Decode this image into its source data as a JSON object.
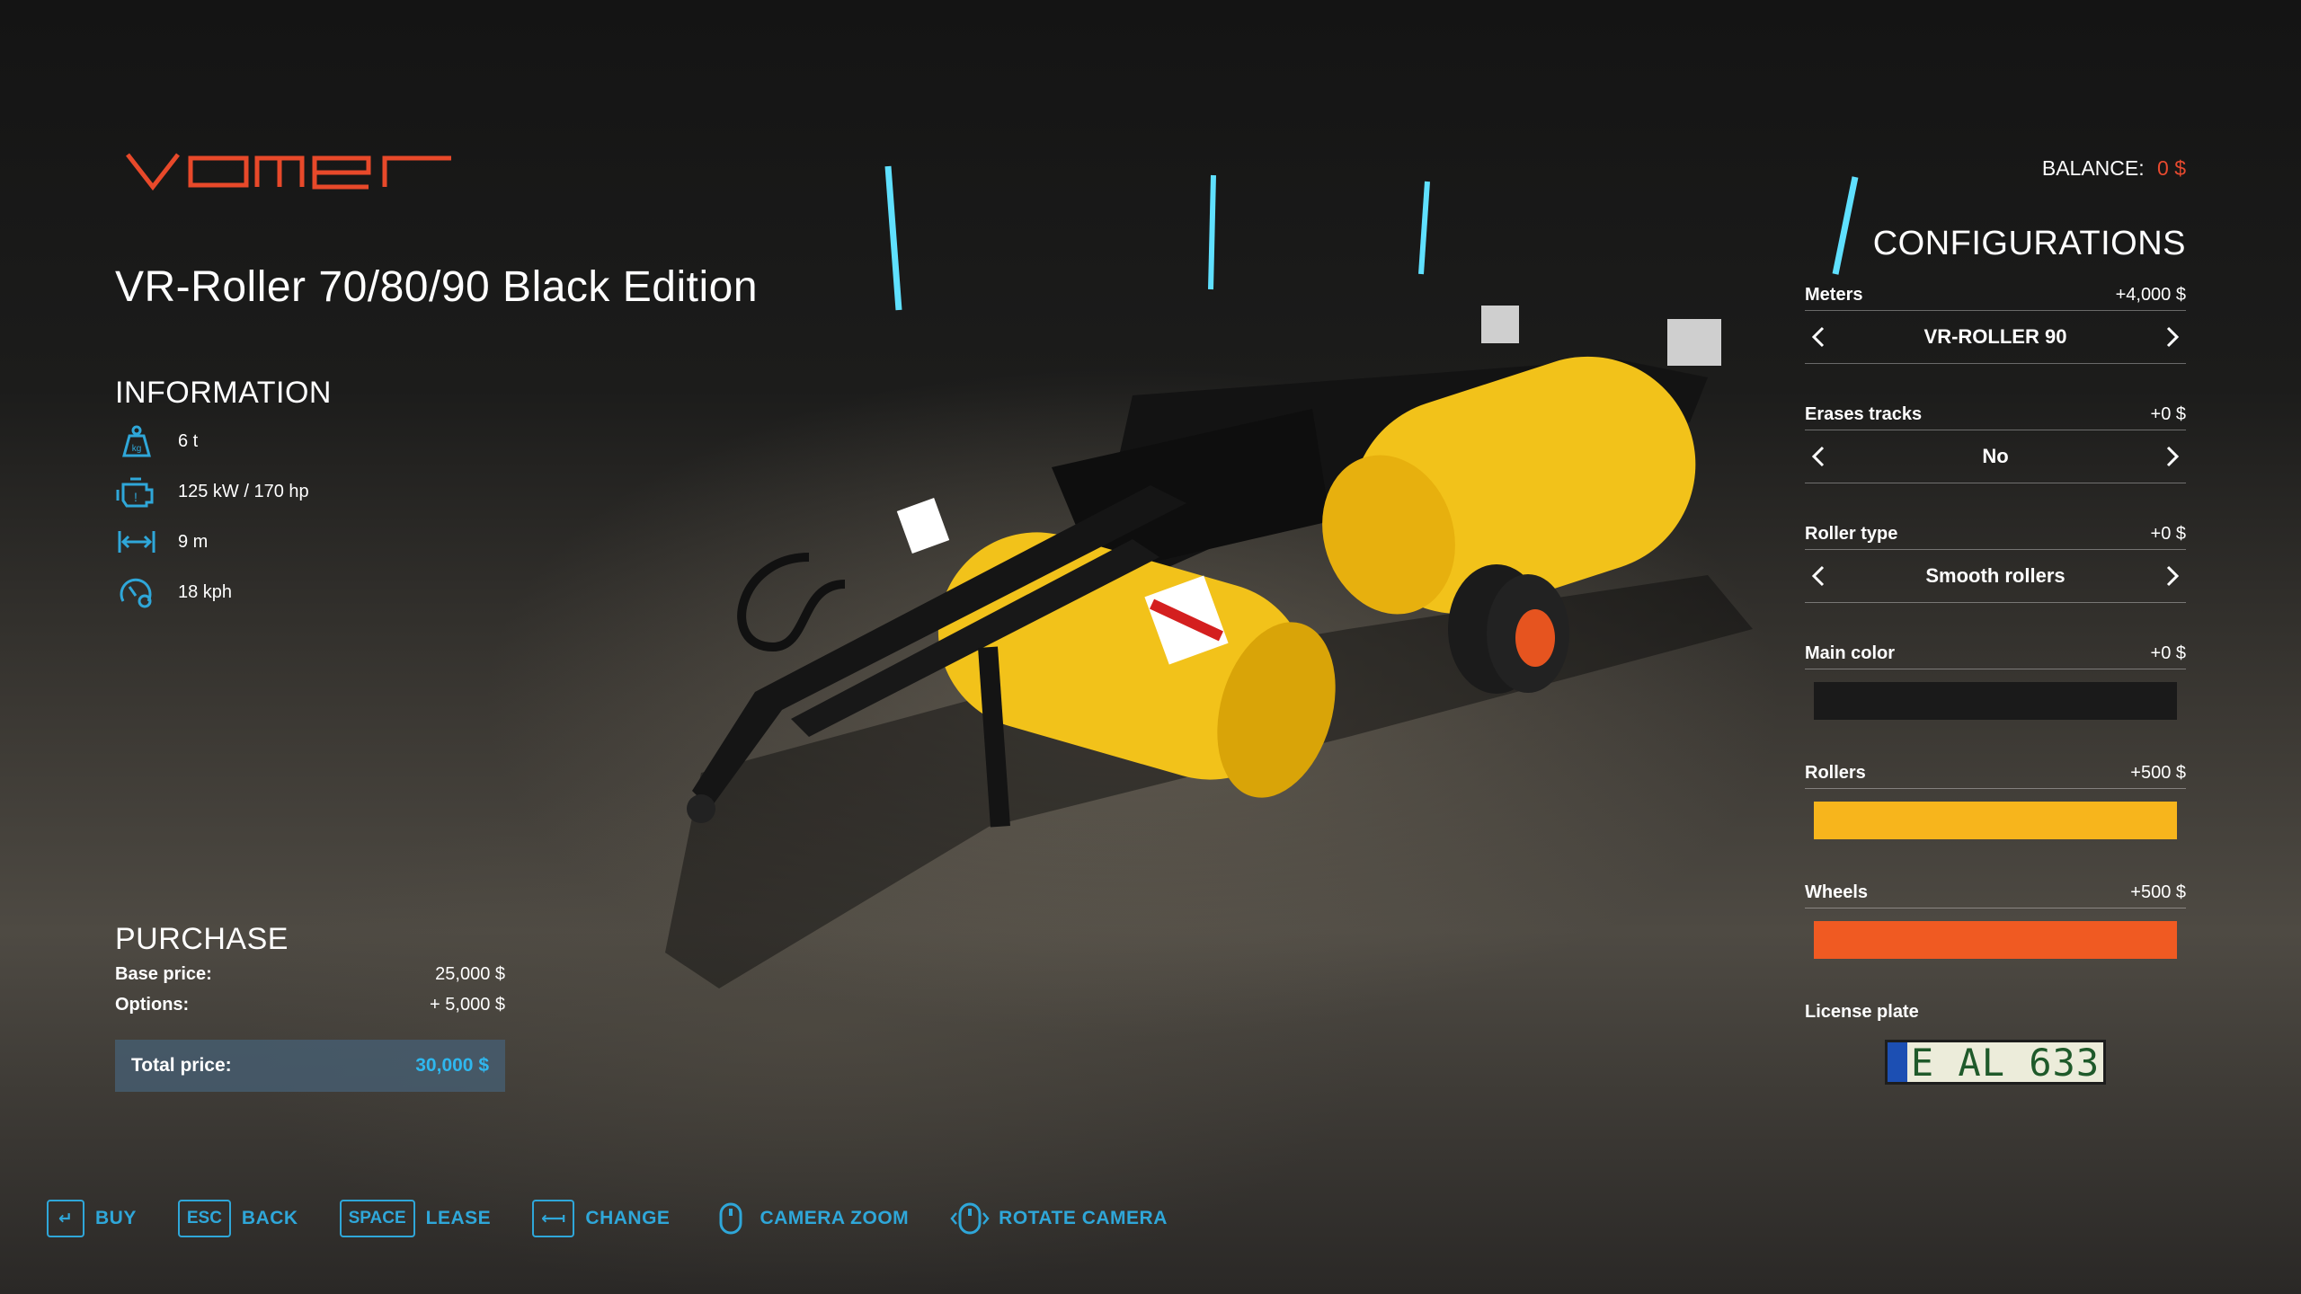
{
  "brand": "vomer",
  "balance": {
    "label": "BALANCE:",
    "value": "0 $"
  },
  "vehicle": {
    "title": "VR-Roller 70/80/90 Black Edition"
  },
  "information": {
    "heading": "INFORMATION",
    "items": [
      {
        "icon": "weight-icon",
        "text": "6 t"
      },
      {
        "icon": "engine-icon",
        "text": "125 kW / 170 hp"
      },
      {
        "icon": "width-icon",
        "text": "9 m"
      },
      {
        "icon": "speed-icon",
        "text": "18 kph"
      }
    ]
  },
  "purchase": {
    "heading": "PURCHASE",
    "base_label": "Base price:",
    "base_value": "25,000 $",
    "options_label": "Options:",
    "options_value": "+ 5,000 $",
    "total_label": "Total price:",
    "total_value": "30,000 $"
  },
  "configurations": {
    "heading": "CONFIGURATIONS",
    "meters": {
      "name": "Meters",
      "price": "+4,000 $",
      "value": "VR-ROLLER 90"
    },
    "erases_tracks": {
      "name": "Erases tracks",
      "price": "+0 $",
      "value": "No"
    },
    "roller_type": {
      "name": "Roller type",
      "price": "+0 $",
      "value": "Smooth rollers"
    },
    "main_color": {
      "name": "Main color",
      "price": "+0 $",
      "color": "#1a1a1a"
    },
    "rollers": {
      "name": "Rollers",
      "price": "+500 $",
      "color": "#f7b51c"
    },
    "wheels": {
      "name": "Wheels",
      "price": "+500 $",
      "color": "#f05a22"
    },
    "license_plate": {
      "name": "License plate",
      "value": "E  AL 633"
    }
  },
  "actions": [
    {
      "key": "↵",
      "label": "BUY"
    },
    {
      "key": "ESC",
      "label": "BACK"
    },
    {
      "key": "SPACE",
      "label": "LEASE"
    },
    {
      "key": "⟻",
      "label": "CHANGE"
    },
    {
      "icon": "mouse-wheel-icon",
      "label": "CAMERA ZOOM"
    },
    {
      "icon": "mouse-drag-icon",
      "label": "ROTATE CAMERA"
    }
  ],
  "colors": {
    "accent": "#2fa7d9",
    "brand": "#e8492a",
    "negative": "#e84a2f"
  }
}
